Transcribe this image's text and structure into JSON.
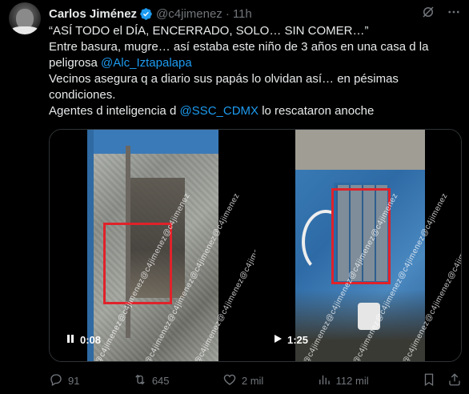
{
  "author": {
    "name": "Carlos Jiménez",
    "handle": "@c4jimenez",
    "separator": "·",
    "time": "11h"
  },
  "tweet": {
    "line1": "“ASÍ TODO el DÍA, ENCERRADO, SOLO… SIN COMER…”",
    "line2": "Entre basura, mugre… así estaba este niño de 3 años en una casa d la",
    "line3_prefix": "peligrosa ",
    "line3_mention": "@Alc_Iztapalapa",
    "line4": "Vecinos asegura q a diario sus papás lo olvidan así… en pésimas",
    "line5": "condiciones.",
    "line6_prefix": "Agentes d inteligencia d ",
    "line6_mention": "@SSC_CDMX",
    "line6_suffix": " lo rescataron anoche"
  },
  "media": {
    "video1": {
      "time": "0:08",
      "state": "pause-icon",
      "watermark": "@c4jimenez@c4jimenez@c4jimenez@c4jimenez"
    },
    "video2": {
      "time": "1:25",
      "state": "play-icon",
      "watermark": "@c4jimenez@c4jimenez@c4jimenez@c4jimenez"
    }
  },
  "actions": {
    "replies": "91",
    "reposts": "645",
    "likes": "2 mil",
    "views": "112 mil"
  },
  "colors": {
    "background": "#000000",
    "text": "#e7e9ea",
    "muted": "#71767b",
    "link": "#1d9bf0",
    "highlight_box": "#e0222a"
  }
}
